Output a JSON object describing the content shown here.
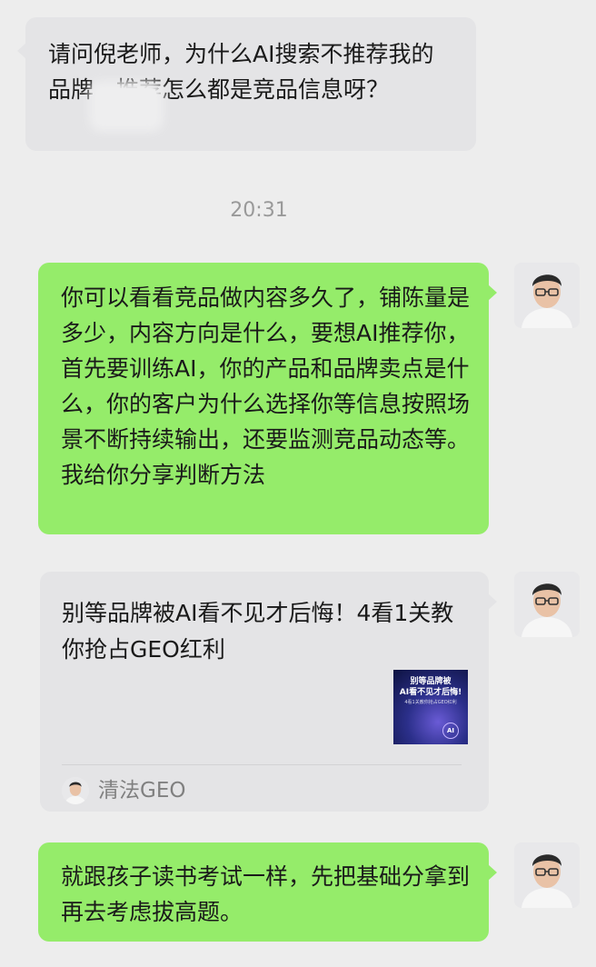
{
  "messages": {
    "m1": {
      "text": "请问倪老师，为什么AI搜索不推荐我的　　品牌，推荐怎么都是竞品信息呀？"
    },
    "time": "20:31",
    "m2": {
      "text": "你可以看看竞品做内容多久了，铺陈量是多少，内容方向是什么，要想AI推荐你，首先要训练AI，你的产品和品牌卖点是什么，你的客户为什么选择你等信息按照场景不断持续输出，还要监测竞品动态等。我给你分享判断方法"
    },
    "m3": {
      "title": "别等品牌被AI看不见才后悔！4看1关教你抢占GEO红利",
      "thumb": {
        "line1": "别等品牌被",
        "line2": "AI看不见才后悔!",
        "line3": "4看1关教你抢占GEO红利",
        "badge": "AI"
      },
      "source": "清法GEO"
    },
    "m4": {
      "text": "就跟孩子读书考试一样，先把基础分拿到再去考虑拔高题。"
    }
  },
  "colors": {
    "background": "#ededed",
    "incoming_bubble": "#e4e4e6",
    "outgoing_bubble": "#95ec6a",
    "timestamp": "#999999"
  },
  "icons": {
    "avatar": "person-avatar-icon"
  }
}
